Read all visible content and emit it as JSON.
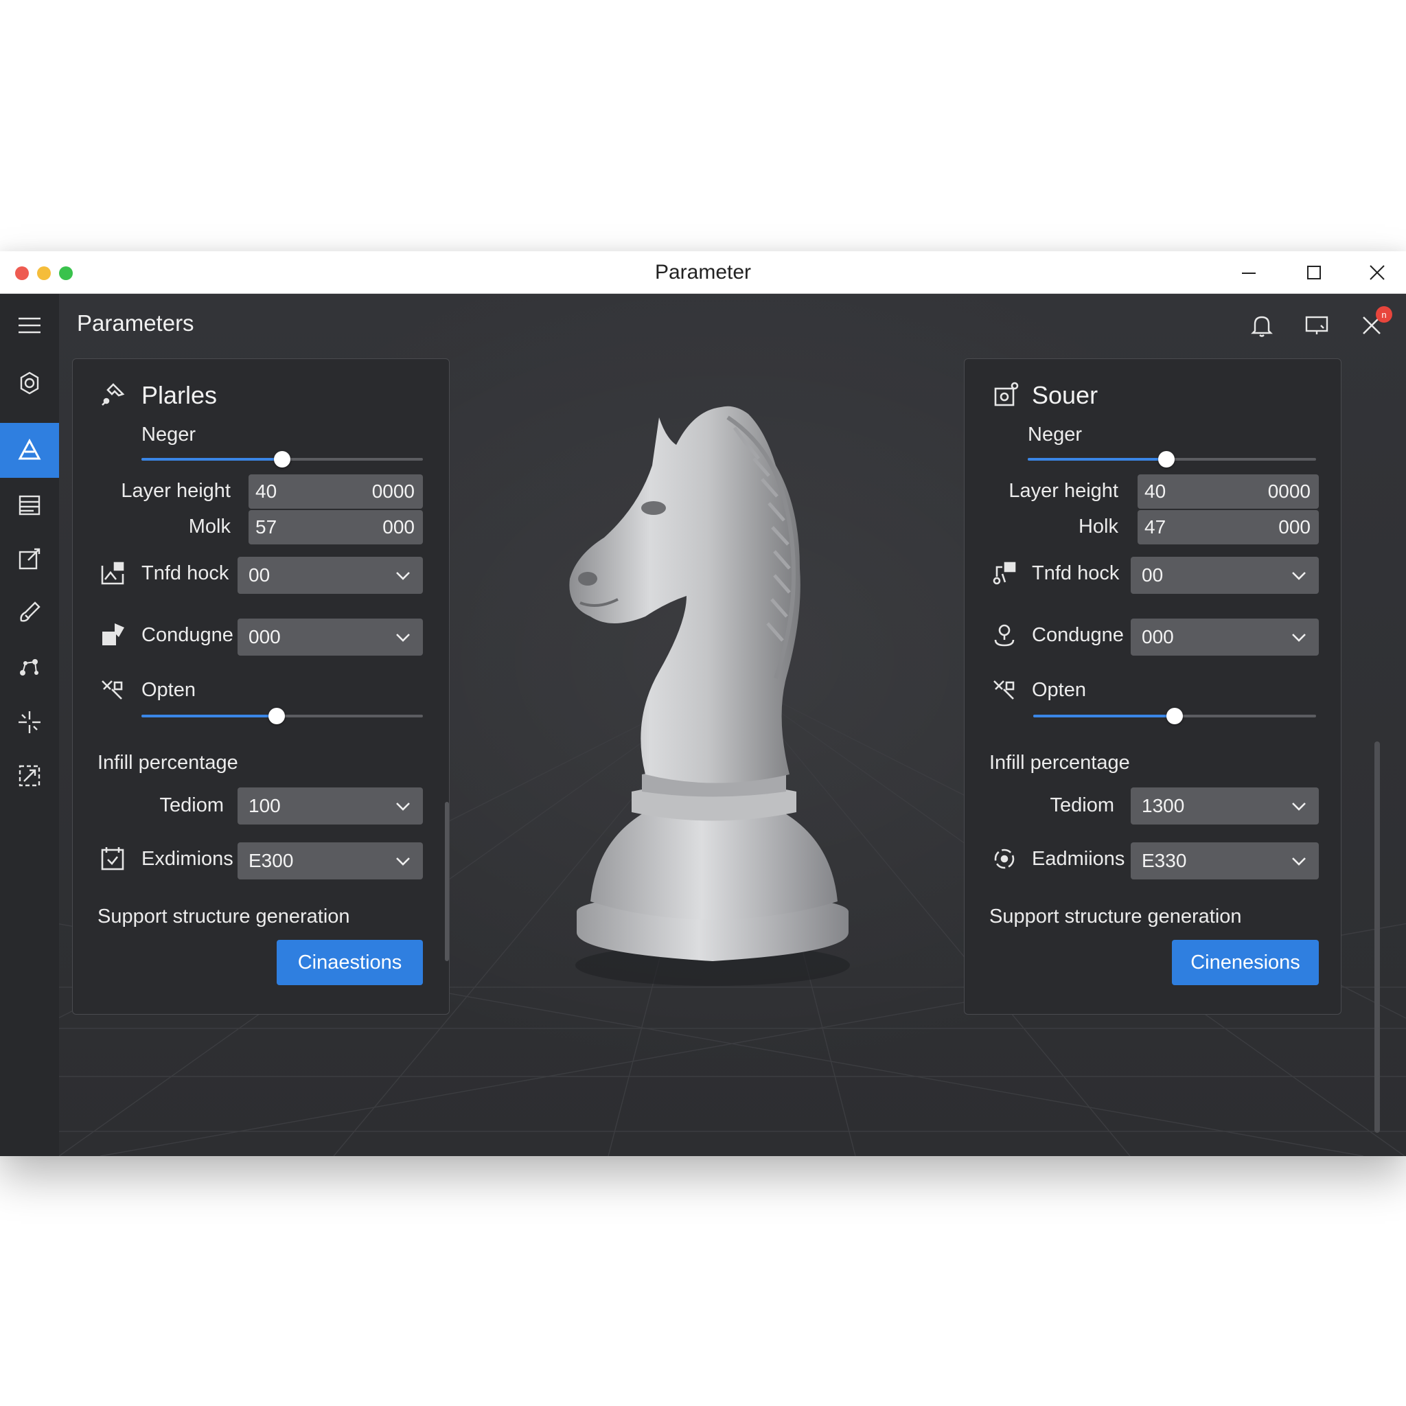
{
  "window": {
    "title": "Parameter"
  },
  "app": {
    "title": "Parameters",
    "notification_badge": "n",
    "accent_color": "#2f7fe0",
    "sidebar_icons": [
      "model-icon",
      "triangle-icon",
      "layers-icon",
      "edit-icon",
      "brush-icon",
      "nodes-icon",
      "sparkle-icon",
      "resize-icon"
    ],
    "active_sidebar_index": 1
  },
  "panels": [
    {
      "title": "Plarles",
      "slider_label": "Neger",
      "slider_value": 0.5,
      "layer_height_label": "Layer height",
      "layer_height_value": "40",
      "layer_height_extra": "0000",
      "holk_label": "Molk",
      "holk_value": "57",
      "holk_extra": "000",
      "tnfd_label": "Tnfd hock",
      "tnfd_value": "00",
      "condugne_label": "Condugne",
      "condugne_value": "000",
      "open_label": "Opten",
      "open_slider_value": 0.48,
      "infill_label": "Infill percentage",
      "tediom_label": "Tediom",
      "tediom_value": "100",
      "exdim_label": "Exdimions",
      "exdim_value": "E300",
      "support_label": "Support structure generation",
      "button_label": "Cinaestions"
    },
    {
      "title": "Souer",
      "slider_label": "Neger",
      "slider_value": 0.48,
      "layer_height_label": "Layer height",
      "layer_height_value": "40",
      "layer_height_extra": "0000",
      "holk_label": "Holk",
      "holk_value": "47",
      "holk_extra": "000",
      "tnfd_label": "Tnfd hock",
      "tnfd_value": "00",
      "condugne_label": "Condugne",
      "condugne_value": "000",
      "open_label": "Opten",
      "open_slider_value": 0.5,
      "infill_label": "Infill percentage",
      "tediom_label": "Tediom",
      "tediom_value": "1300",
      "exdim_label": "Eadmiions",
      "exdim_value": "E330",
      "support_label": "Support structure generation",
      "button_label": "Cinenesions"
    }
  ]
}
